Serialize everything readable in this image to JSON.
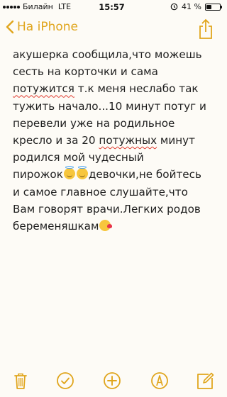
{
  "status_bar": {
    "carrier": "Билайн",
    "network": "LTE",
    "time": "15:57",
    "battery_text": "41 %",
    "battery_level": 0.41
  },
  "nav": {
    "back_label": "На iPhone",
    "accent_color": "#e0a51c"
  },
  "note": {
    "lines": [
      "акушерка сообщила,что можешь",
      "сесть на корточки и сама",
      "т.к меня неслабо так",
      "тужить начало...10 минут потуг и",
      "перевели уже на родильное",
      "кресло и за 20",
      "минут",
      "родился мой чудесный",
      "пирожок",
      "девочки,не бойтесь",
      "и самое главное слушайте,что",
      "Вам говорят врачи.Легких родов",
      "беременяшкам"
    ],
    "misspelled": [
      "потужится",
      "потужных"
    ]
  },
  "toolbar": {
    "icons": [
      "trash-icon",
      "checklist-icon",
      "add-icon",
      "markup-icon",
      "compose-icon"
    ]
  }
}
